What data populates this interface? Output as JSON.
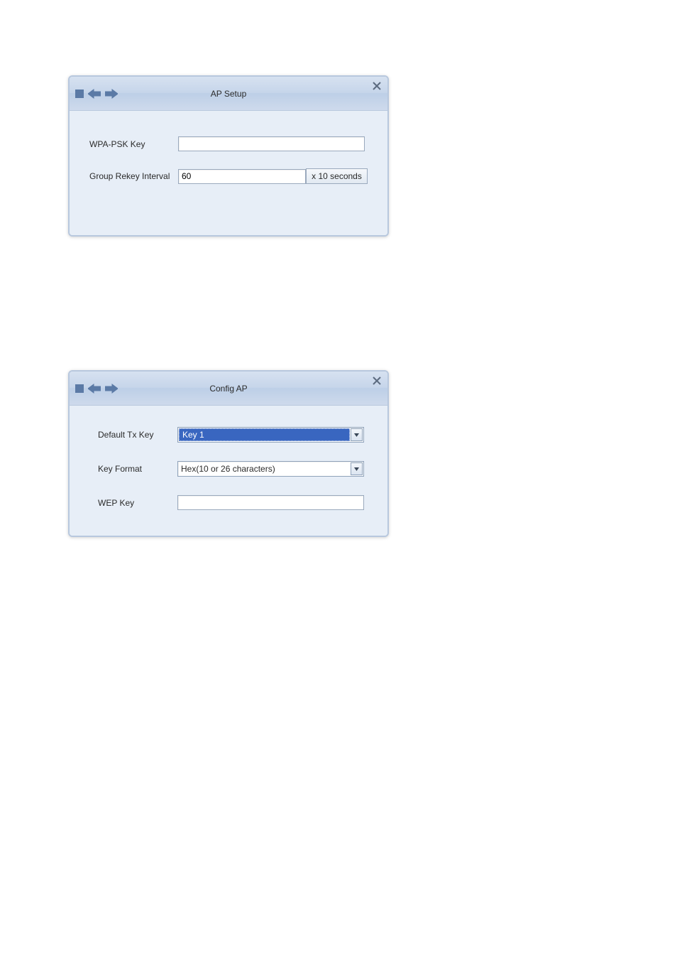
{
  "window1": {
    "title": "AP Setup",
    "fields": {
      "wpa_psk_label": "WPA-PSK Key",
      "wpa_psk_value": "",
      "rekey_label": "Group Rekey Interval",
      "rekey_value": "60",
      "rekey_unit": "x 10 seconds"
    }
  },
  "window2": {
    "title": "Config AP",
    "fields": {
      "default_tx_label": "Default Tx Key",
      "default_tx_value": "Key 1",
      "key_format_label": "Key Format",
      "key_format_value": "Hex(10 or 26 characters)",
      "wep_key_label": "WEP Key",
      "wep_key_value": ""
    }
  }
}
